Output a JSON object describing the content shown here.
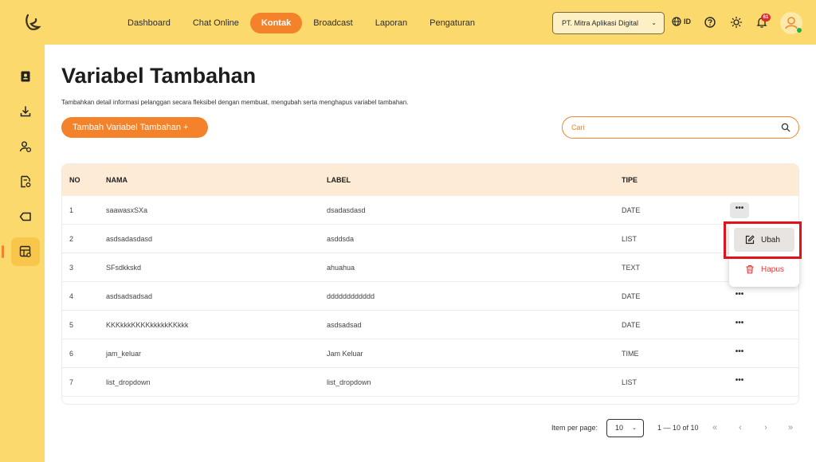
{
  "nav": [
    "Dashboard",
    "Chat Online",
    "Kontak",
    "Broadcast",
    "Laporan",
    "Pengaturan"
  ],
  "nav_active": "Kontak",
  "company": "PT. Mitra Aplikasi Digital",
  "language": "ID",
  "notifications": "61",
  "page": {
    "title": "Variabel Tambahan",
    "subtitle": "Tambahkan detail informasi pelanggan secara fleksibel dengan membuat, mengubah serta menghapus variabel tambahan.",
    "add_label": "Tambah Variabel Tambahan +",
    "search_placeholder": "Cari"
  },
  "table": {
    "headers": [
      "NO",
      "NAMA",
      "LABEL",
      "TIPE"
    ],
    "rows": [
      [
        "1",
        "saawasxSXa",
        "dsadasdasd",
        "DATE"
      ],
      [
        "2",
        "asdsadasdasd",
        "asddsda",
        "LIST"
      ],
      [
        "3",
        "SFsdkkskd",
        "ahuahua",
        "TEXT"
      ],
      [
        "4",
        "asdsadsadsad",
        "dddddddddddd",
        "DATE"
      ],
      [
        "5",
        "KKKkkkKKKKkkkkkKKkkk",
        "asdsadsad",
        "DATE"
      ],
      [
        "6",
        "jam_keluar",
        "Jam Keluar",
        "TIME"
      ],
      [
        "7",
        "list_dropdown",
        "list_dropdown",
        "LIST"
      ]
    ],
    "more": "•••"
  },
  "menu": {
    "edit": "Ubah",
    "delete": "Hapus"
  },
  "pagination": {
    "per_page_label": "Item per page:",
    "per_page": "10",
    "range": "1 — 10 of 10"
  },
  "colors": {
    "accent": "#f4822a",
    "topbar": "#fbd96d",
    "danger": "#e83b3b"
  },
  "icons": {
    "sidebar": [
      "contact-book-icon",
      "download-icon",
      "user-settings-icon",
      "document-settings-icon",
      "label-tag-icon",
      "table-settings-icon"
    ],
    "topbar": [
      "globe-icon",
      "help-icon",
      "sun-icon",
      "bell-icon",
      "avatar-icon"
    ]
  }
}
